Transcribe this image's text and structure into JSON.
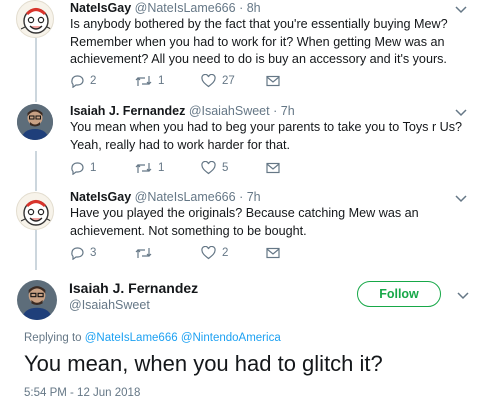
{
  "tweets": [
    {
      "name": "NateIsGay",
      "handle": "@NateIsLame666",
      "sep": "·",
      "time": "8h",
      "text": "Is anybody bothered by the fact that you're essentially buying Mew? Remember when you had to work for it? When getting Mew was an achievement? All you need to do is buy an accessory and it's yours.",
      "replies": "2",
      "retweets": "1",
      "likes": "27"
    },
    {
      "name": "Isaiah J. Fernandez",
      "handle": "@IsaiahSweet",
      "sep": "·",
      "time": "7h",
      "text": "You mean when you had to beg your parents to take you to Toys r Us? Yeah, really had to work harder for that.",
      "replies": "1",
      "retweets": "1",
      "likes": "5"
    },
    {
      "name": "NateIsGay",
      "handle": "@NateIsLame666",
      "sep": "·",
      "time": "7h",
      "text": "Have you played the originals? Because catching Mew was an achievement. Not something to be bought.",
      "replies": "3",
      "retweets": "",
      "likes": "2"
    }
  ],
  "main": {
    "name": "Isaiah J. Fernandez",
    "handle": "@IsaiahSweet",
    "follow_label": "Follow",
    "replying_to_label": "Replying to",
    "replying_to_1": "@NateIsLame666",
    "replying_to_2": "@NintendoAmerica",
    "text": "You mean, when you had to glitch it?",
    "timestamp": "5:54 PM - 12 Jun 2018"
  },
  "colors": {
    "accent": "#1da1f2",
    "follow_green": "#17a848",
    "meta_gray": "#657786",
    "thread_line": "#ccd6dd"
  },
  "icons": [
    "reply-icon",
    "retweet-icon",
    "like-icon",
    "message-icon",
    "caret-down-icon"
  ]
}
